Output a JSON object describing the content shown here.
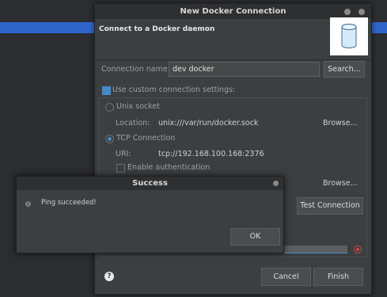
{
  "main_dialog": {
    "title": "New Docker Connection",
    "header_text": "Connect to a Docker daemon",
    "connection_name_label": "Connection name:",
    "connection_name_value": "dev docker",
    "search_button": "Search...",
    "custom_settings_label": "Use custom connection settings:",
    "unix_socket_label": "Unix socket",
    "location_label": "Location:",
    "location_value": "unix:///var/run/docker.sock",
    "browse_button_1": "Browse...",
    "tcp_label": "TCP Connection",
    "uri_label": "URI:",
    "uri_value": "tcp://192.168.100.168:2376",
    "enable_auth_label": "Enable authentication",
    "browse_button_2": "Browse...",
    "test_connection_button": "Test Connection",
    "cancel_button": "Cancel",
    "finish_button": "Finish",
    "help_icon_glyph": "?"
  },
  "success_dialog": {
    "title": "Success",
    "message": "Ping succeeded!",
    "ok_button": "OK",
    "info_icon_glyph": "i"
  },
  "colors": {
    "accent": "#4a88c7",
    "background": "#3c3f41",
    "error": "#c74a4a"
  }
}
